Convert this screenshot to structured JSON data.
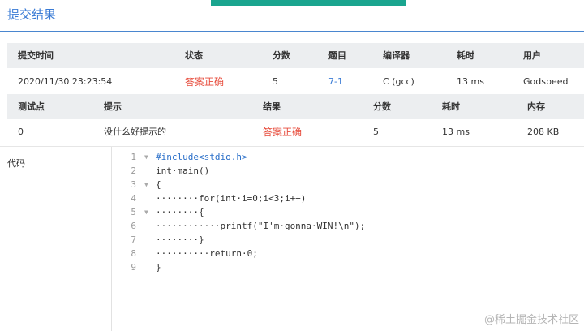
{
  "page": {
    "title": "提交结果"
  },
  "summary": {
    "headers": [
      "提交时间",
      "状态",
      "分数",
      "题目",
      "编译器",
      "耗时",
      "用户"
    ],
    "row": {
      "time": "2020/11/30 23:23:54",
      "status": "答案正确",
      "score": "5",
      "problem": "7-1",
      "compiler": "C (gcc)",
      "elapsed": "13 ms",
      "user": "Godspeed"
    }
  },
  "tests": {
    "headers": [
      "测试点",
      "提示",
      "结果",
      "分数",
      "耗时",
      "内存"
    ],
    "row": {
      "point": "0",
      "hint": "没什么好提示的",
      "result": "答案正确",
      "score": "5",
      "elapsed": "13 ms",
      "memory": "208 KB"
    }
  },
  "code": {
    "label": "代码",
    "lines": [
      {
        "no": "1",
        "text": "#include<stdio.h>"
      },
      {
        "no": "2",
        "text": "int·main()"
      },
      {
        "no": "3",
        "text": "{"
      },
      {
        "no": "4",
        "text": "········for(int·i=0;i<3;i++)"
      },
      {
        "no": "5",
        "text": "········{"
      },
      {
        "no": "6",
        "text": "············printf(\"I'm·gonna·WIN!\\n\");"
      },
      {
        "no": "7",
        "text": "········}"
      },
      {
        "no": "8",
        "text": "··········return·0;"
      },
      {
        "no": "9",
        "text": "}"
      }
    ]
  },
  "watermark": "@稀土掘金技术社区",
  "colors": {
    "accent": "#3a7bd5",
    "success_text": "#e74c3c",
    "top_bar": "#1aa58f",
    "header_bg": "#eceef0"
  }
}
